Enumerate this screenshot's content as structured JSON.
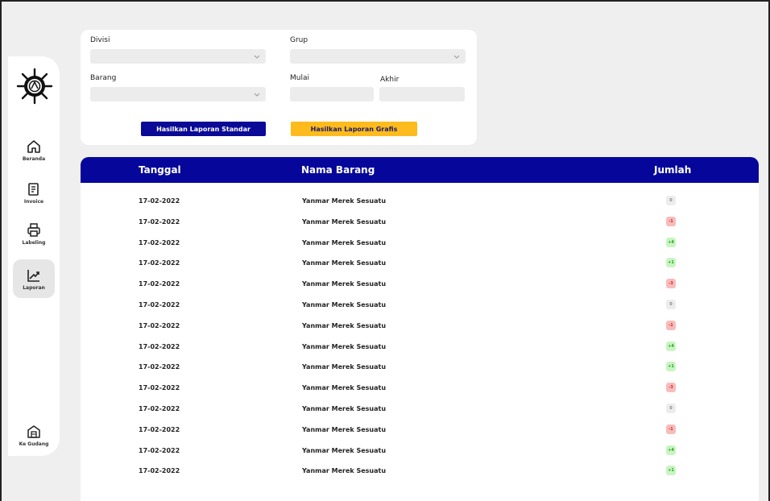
{
  "sidebar": {
    "items": [
      {
        "id": "beranda",
        "label": "Beranda",
        "icon": "home-icon"
      },
      {
        "id": "invoice",
        "label": "Invoice",
        "icon": "receipt-icon"
      },
      {
        "id": "labeling",
        "label": "Labeling",
        "icon": "printer-icon"
      },
      {
        "id": "laporan",
        "label": "Laporan",
        "icon": "chart-up-icon",
        "active": true
      }
    ],
    "bottom": {
      "label": "Ke Gudang",
      "icon": "warehouse-icon"
    }
  },
  "filters": {
    "divisi_label": "Divisi",
    "grup_label": "Grup",
    "barang_label": "Barang",
    "mulai_label": "Mulai",
    "akhir_label": "Akhir",
    "divisi_value": "",
    "grup_value": "",
    "barang_value": "",
    "mulai_value": "",
    "akhir_value": ""
  },
  "buttons": {
    "standar": "Hasilkan Laporan Standar",
    "grafis": "Hasilkan Laporan Grafis"
  },
  "table": {
    "headers": {
      "tanggal": "Tanggal",
      "nama": "Nama Barang",
      "jumlah": "Jumlah"
    },
    "rows": [
      {
        "tanggal": "17-02-2022",
        "nama": "Yanmar Merek Sesuatu",
        "jumlah": "0",
        "status": "neutral"
      },
      {
        "tanggal": "17-02-2022",
        "nama": "Yanmar Merek Sesuatu",
        "jumlah": "-1",
        "status": "neg"
      },
      {
        "tanggal": "17-02-2022",
        "nama": "Yanmar Merek Sesuatu",
        "jumlah": "+4",
        "status": "pos"
      },
      {
        "tanggal": "17-02-2022",
        "nama": "Yanmar Merek Sesuatu",
        "jumlah": "+1",
        "status": "pos"
      },
      {
        "tanggal": "17-02-2022",
        "nama": "Yanmar Merek Sesuatu",
        "jumlah": "-3",
        "status": "neg"
      },
      {
        "tanggal": "17-02-2022",
        "nama": "Yanmar Merek Sesuatu",
        "jumlah": "0",
        "status": "neutral"
      },
      {
        "tanggal": "17-02-2022",
        "nama": "Yanmar Merek Sesuatu",
        "jumlah": "-1",
        "status": "neg"
      },
      {
        "tanggal": "17-02-2022",
        "nama": "Yanmar Merek Sesuatu",
        "jumlah": "+4",
        "status": "pos"
      },
      {
        "tanggal": "17-02-2022",
        "nama": "Yanmar Merek Sesuatu",
        "jumlah": "+1",
        "status": "pos"
      },
      {
        "tanggal": "17-02-2022",
        "nama": "Yanmar Merek Sesuatu",
        "jumlah": "-3",
        "status": "neg"
      },
      {
        "tanggal": "17-02-2022",
        "nama": "Yanmar Merek Sesuatu",
        "jumlah": "0",
        "status": "neutral"
      },
      {
        "tanggal": "17-02-2022",
        "nama": "Yanmar Merek Sesuatu",
        "jumlah": "-1",
        "status": "neg"
      },
      {
        "tanggal": "17-02-2022",
        "nama": "Yanmar Merek Sesuatu",
        "jumlah": "+4",
        "status": "pos"
      },
      {
        "tanggal": "17-02-2022",
        "nama": "Yanmar Merek Sesuatu",
        "jumlah": "+1",
        "status": "pos"
      }
    ]
  },
  "colors": {
    "primary": "#06079a",
    "accent": "#fdbb1d",
    "background": "#efefef"
  }
}
